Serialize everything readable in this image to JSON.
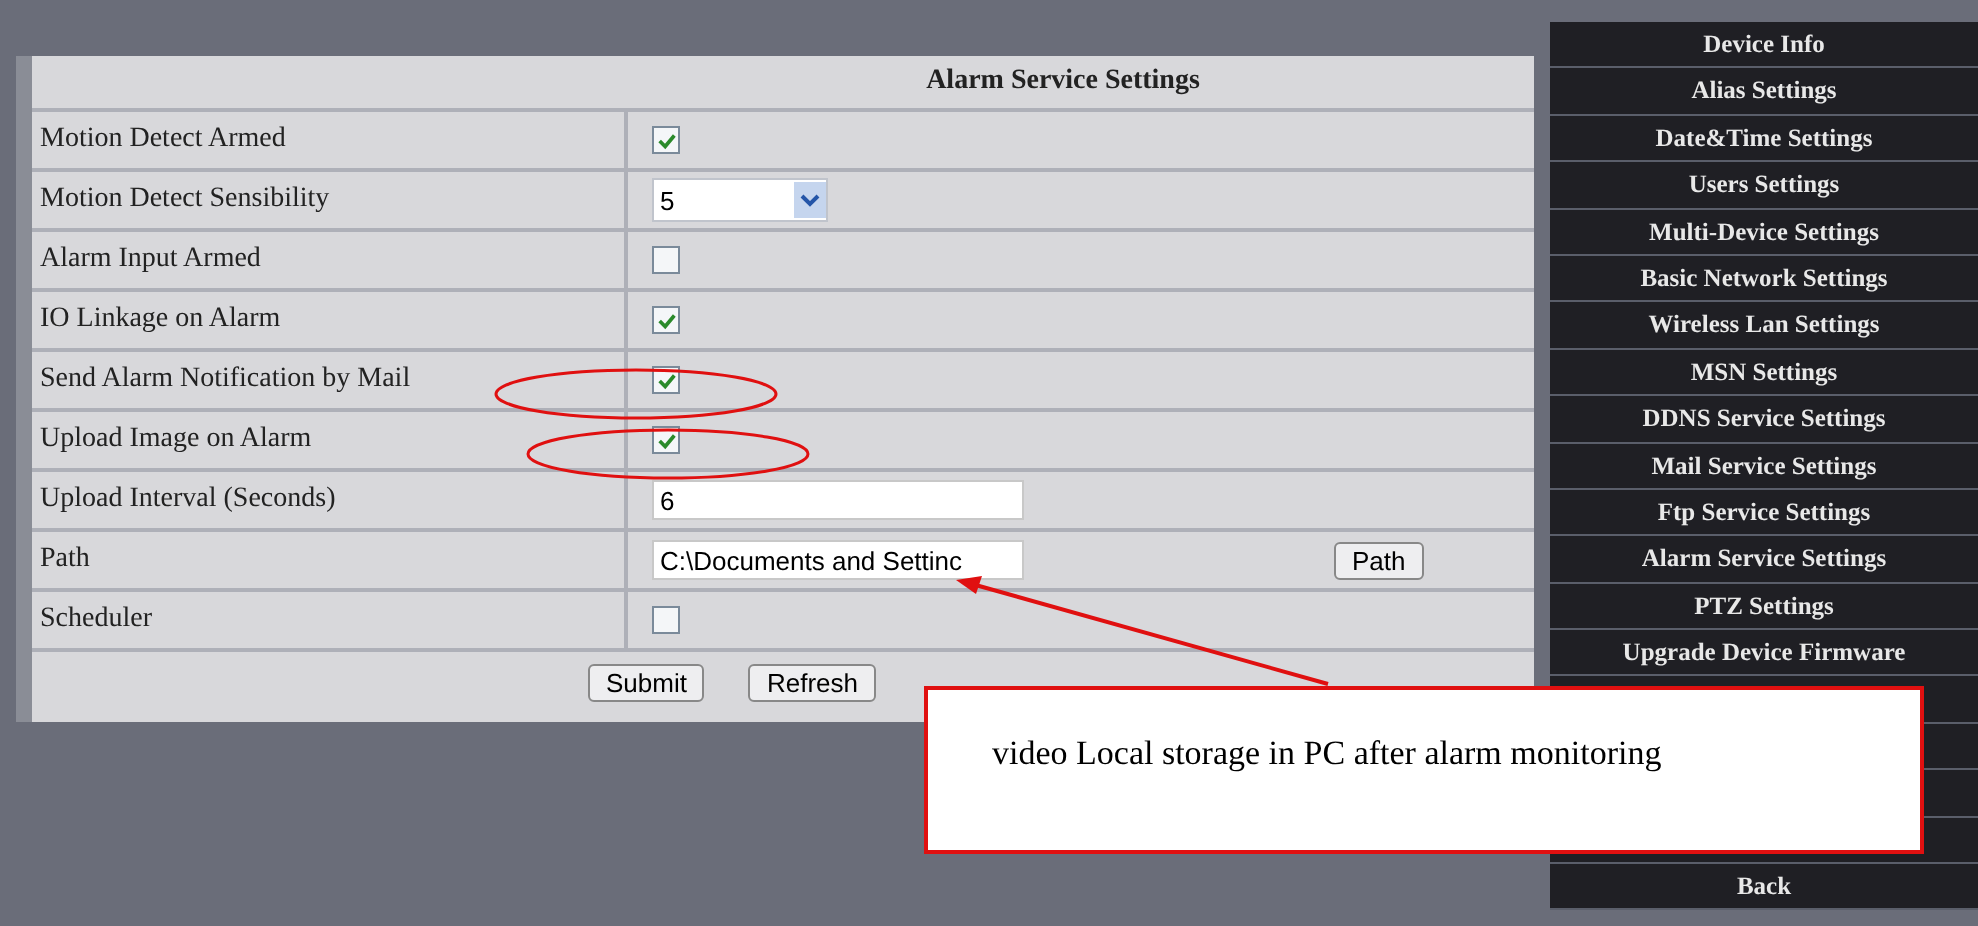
{
  "settings": {
    "title": "Alarm Service Settings",
    "rows": [
      {
        "label": "Motion Detect Armed",
        "kind": "checkbox",
        "checked": true
      },
      {
        "label": "Motion Detect Sensibility",
        "kind": "select",
        "value": "5"
      },
      {
        "label": "Alarm Input Armed",
        "kind": "checkbox",
        "checked": false
      },
      {
        "label": "IO Linkage on Alarm",
        "kind": "checkbox",
        "checked": true
      },
      {
        "label": "Send Alarm Notification by Mail",
        "kind": "checkbox",
        "checked": true
      },
      {
        "label": "Upload Image on Alarm",
        "kind": "checkbox",
        "checked": true
      },
      {
        "label": "Upload Interval (Seconds)",
        "kind": "text",
        "value": "6"
      },
      {
        "label": "Path",
        "kind": "path",
        "value": "C:\\Documents and Settinc",
        "button": "Path"
      },
      {
        "label": "Scheduler",
        "kind": "checkbox",
        "checked": false
      }
    ],
    "buttons": [
      "Submit",
      "Refresh"
    ]
  },
  "sidebar": {
    "items": [
      "Device Info",
      "Alias Settings",
      "Date&Time Settings",
      "Users Settings",
      "Multi-Device Settings",
      "Basic Network Settings",
      "Wireless Lan Settings",
      "MSN Settings",
      "DDNS Service Settings",
      "Mail Service Settings",
      "Ftp Service Settings",
      "Alarm Service Settings",
      "PTZ Settings",
      "Upgrade Device Firmware"
    ],
    "back": "Back"
  },
  "callout": {
    "text": "video Local storage in PC after alarm monitoring"
  }
}
